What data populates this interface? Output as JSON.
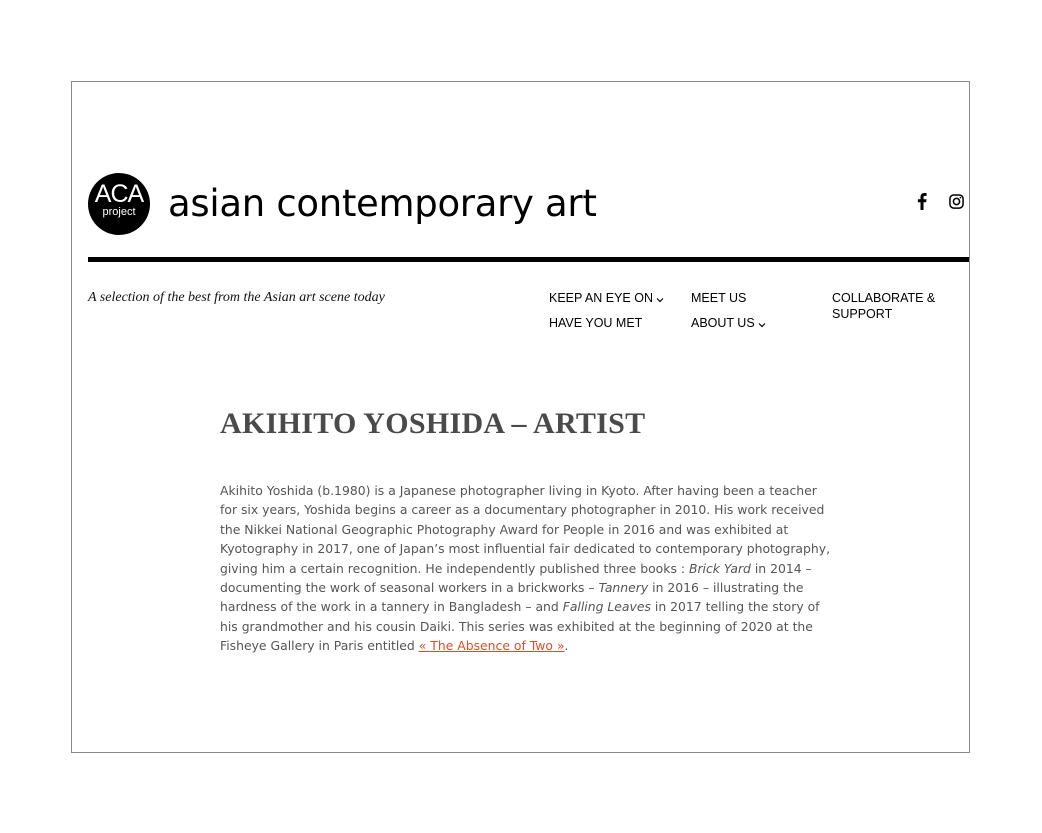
{
  "site": {
    "logo": {
      "line1": "ACA",
      "line2": "project"
    },
    "title": "asian contemporary art",
    "tagline": "A selection of the best from the Asian art scene today",
    "social": [
      {
        "name": "facebook-icon"
      },
      {
        "name": "instagram-icon"
      }
    ]
  },
  "nav": {
    "keep_an_eye_on": "KEEP AN EYE ON",
    "meet_us": "MEET US",
    "collaborate_support": "COLLABORATE & SUPPORT",
    "have_you_met": "HAVE YOU MET",
    "about_us": "ABOUT US"
  },
  "article": {
    "title": "AKIHITO YOSHIDA – ARTIST",
    "p1": "Akihito Yoshida (b.1980) is a Japanese photographer living in Kyoto. After having been a teacher for six years, Yoshida begins a career as a documentary photographer in 2010. His work received the Nikkei National Geographic Photography Award for People in 2016 and was exhibited at Kyotography in 2017, one of Japan’s most influential fair dedicated to contemporary photography, giving him a certain recognition. He independently published three books : ",
    "book1": "Brick Yard",
    "p2": " in 2014 – documenting the work of seasonal workers in a brickworks – ",
    "book2": "Tannery",
    "p3": " in 2016 – illustrating the hardness of the work in a tannery in Bangladesh – and ",
    "book3": "Falling Leaves",
    "p4": " in 2017 telling the story of his grandmother and his cousin Daiki. This series was exhibited at the beginning of 2020 at the Fisheye Gallery in Paris entitled ",
    "link_text": "« The Absence of Two »",
    "p5": "."
  },
  "colors": {
    "link": "#d94f2b",
    "title": "#4a4a4a",
    "body_text": "#555555",
    "header_rule": "#000000"
  }
}
